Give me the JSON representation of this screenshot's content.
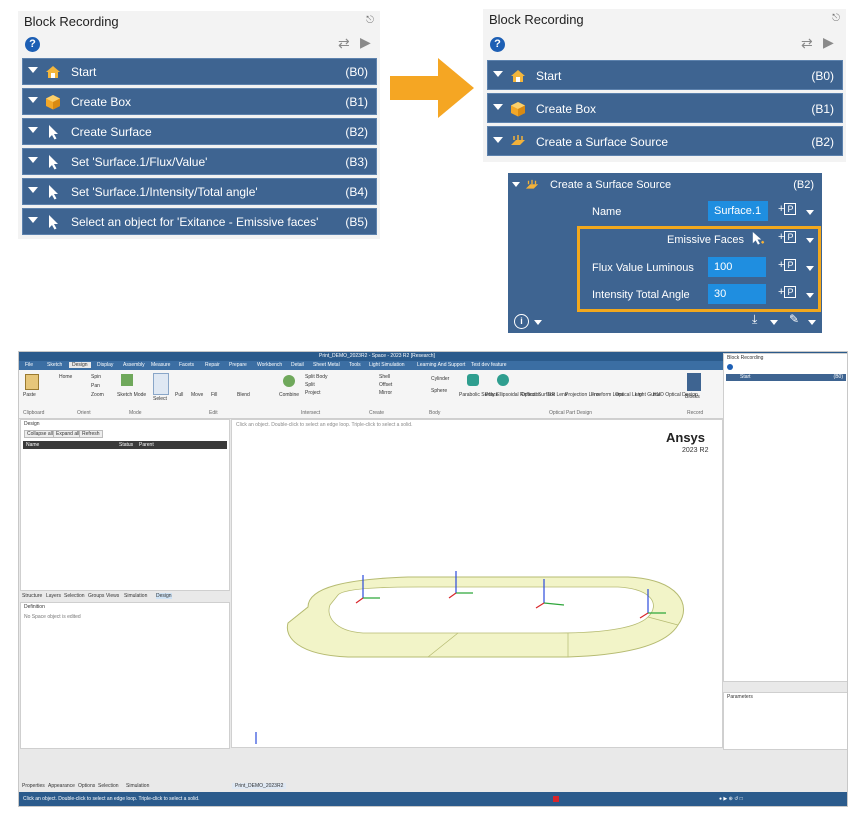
{
  "left_panel": {
    "title": "Block Recording",
    "help": "?",
    "rows": [
      {
        "label": "Start",
        "code": "(B0)",
        "icon": "home-icon"
      },
      {
        "label": "Create Box",
        "code": "(B1)",
        "icon": "cube-icon"
      },
      {
        "label": "Create Surface",
        "code": "(B2)",
        "icon": "cursor-icon"
      },
      {
        "label": "Set 'Surface.1/Flux/Value'",
        "code": "(B3)",
        "icon": "cursor-icon"
      },
      {
        "label": "Set 'Surface.1/Intensity/Total angle'",
        "code": "(B4)",
        "icon": "cursor-icon"
      },
      {
        "label": "Select an object for 'Exitance - Emissive faces'",
        "code": "(B5)",
        "icon": "cursor-icon"
      }
    ]
  },
  "right_panel": {
    "title": "Block Recording",
    "help": "?",
    "rows": [
      {
        "label": "Start",
        "code": "(B0)",
        "icon": "home-icon"
      },
      {
        "label": "Create Box",
        "code": "(B1)",
        "icon": "cube-icon"
      },
      {
        "label": "Create a Surface Source",
        "code": "(B2)",
        "icon": "surface-source-icon"
      }
    ]
  },
  "detail": {
    "header": "Create a Surface Source",
    "code": "(B2)",
    "name_label": "Name",
    "name_value": "Surface.1",
    "emissive_label": "Emissive Faces",
    "flux_label": "Flux Value Luminous",
    "flux_value": "100",
    "intensity_label": "Intensity Total Angle",
    "intensity_value": "30",
    "param_glyph": "P",
    "info": "i"
  },
  "colors": {
    "row_bg": "#3e6491",
    "field_bg": "#1f8ee0",
    "highlight": "#f2a81d",
    "arrow": "#f5a623"
  },
  "app": {
    "window_title": "Print_DEMO_2023R2 - Space - 2023 R2 [Research]",
    "menu": [
      "File",
      "Sketch",
      "Design",
      "Display",
      "Assembly",
      "Measure",
      "Facets",
      "Repair",
      "Prepare",
      "Workbench",
      "Detail",
      "Sheet Metal",
      "Tools",
      "Light Simulation",
      "Learning And Support",
      "Test dev feature"
    ],
    "ribbon_groups": [
      "Clipboard",
      "Orient",
      "Mode",
      "Edit",
      "Intersect",
      "Create",
      "Body",
      "Optical Part Design",
      "Record"
    ],
    "ribbon_buttons": {
      "paste": "Paste",
      "home": "Home",
      "spin": "Spin",
      "pan": "Pan",
      "zoom": "Zoom",
      "sketch_mode": "Sketch Mode",
      "select": "Select",
      "pull": "Pull",
      "move": "Move",
      "fill": "Fill",
      "blend": "Blend",
      "combine": "Combine",
      "split_body": "Split Body",
      "split": "Split",
      "project": "Project",
      "shell": "Shell",
      "offset": "Offset",
      "mirror": "Mirror",
      "cylinder": "Cylinder",
      "sphere": "Sphere",
      "parabolic_surface": "Parabolic Surface",
      "poly_ellipsoidal": "Poly Ellipsoidal Reflector",
      "optical_surface": "Optical Surface",
      "tir_lens": "TIR Lens",
      "projection_lens": "Projection Lens",
      "freeform_lens": "Freeform Lens",
      "optical_lens": "Optical Lens",
      "light_guide": "Light Guide",
      "hud_optical_design": "HUD Optical Design",
      "blocks": "Blocks"
    },
    "design_panel": {
      "title": "Design",
      "collapse_all": "Collapse all",
      "expand_all": "Expand all",
      "refresh": "Refresh",
      "col_name": "Name",
      "col_status": "Status",
      "col_parent": "Parent"
    },
    "structure_tabs": [
      "Structure",
      "Layers",
      "Selection",
      "Groups",
      "Views",
      "Simulation",
      "Design"
    ],
    "definition_title": "Definition",
    "definition_msg": "No Space object is edited",
    "viewport_hint": "Click an object. Double-click to select an edge loop. Triple-click to select a solid.",
    "brand": "Ansys",
    "brand_version": "2023 R2",
    "block_panel": {
      "title": "Block Recording",
      "row": "Start",
      "code": "(B0)"
    },
    "parameters_title": "Parameters",
    "bottom_tabs": [
      "Properties",
      "Appearance",
      "Options",
      "Selection",
      "Simulation"
    ],
    "doc_tab": "Print_DEMO_2023R2",
    "status_text": "Click an object. Double-click to select an edge loop. Triple-click to select a solid."
  }
}
